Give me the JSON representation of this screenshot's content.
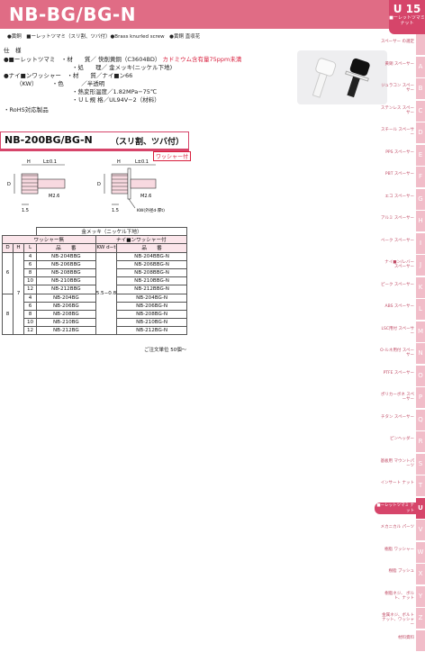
{
  "header": {
    "title": "NB-BG/BG-N",
    "badge_code": "U 15",
    "badge_label": "■ーレットツマミ ナット"
  },
  "taglines": "●黄銅　■ーレットツマミ（スリ割、ツバ付）●Brass knurled screw　●黄銅 直収花",
  "specs": {
    "section_title": "仕　様",
    "l1a": "●■ーレットツマミ　・材　　質／ 快削黄銅（C3604BD）",
    "l1b": "カドミウム含有量75ppm未満",
    "l2": "・処　　理／ 金メッキ(ニッケル下地)",
    "l3": "●ナイ■ンワッシャー　・材　　質／ナイ■ン66",
    "l4": "（KW）　　　・色　　　／半透明",
    "l5": "・熱変形温度／1.82MPa−75℃",
    "l6": "・ＵＬ規 格／UL94V−2（材料）",
    "rohs": "・RoHS対応製品"
  },
  "section": {
    "model": "NB-200BG/BG-N",
    "note": "（スリ割、ツバ付）",
    "washer_tag": "ワッシャー付"
  },
  "drawing": {
    "h": "H",
    "l": "L±0.1",
    "d": "D",
    "m": "M2.6",
    "dim15": "1.5",
    "kw": "KW(外径d·厚t)"
  },
  "table": {
    "caption": "金メッキ（ニッケル下地）",
    "group1": "ワッシャー無",
    "group2": "ナイ■ンワッシャー付",
    "col_d": "D",
    "col_h": "H",
    "col_l": "L",
    "col_p1": "品　　番",
    "col_kw": "KW d−t",
    "col_p2": "品　　番",
    "d_vals": [
      "6",
      "8"
    ],
    "h_val": "7",
    "kw_val": "5.5−0.8",
    "rows": [
      {
        "l": "4",
        "p1": "NB-204BBG",
        "p2": "NB-204BBG-N"
      },
      {
        "l": "6",
        "p1": "NB-206BBG",
        "p2": "NB-206BBG-N"
      },
      {
        "l": "8",
        "p1": "NB-208BBG",
        "p2": "NB-208BBG-N"
      },
      {
        "l": "10",
        "p1": "NB-210BBG",
        "p2": "NB-210BBG-N"
      },
      {
        "l": "12",
        "p1": "NB-212BBG",
        "p2": "NB-212BBG-N"
      },
      {
        "l": "4",
        "p1": "NB-204BG",
        "p2": "NB-204BG-N"
      },
      {
        "l": "6",
        "p1": "NB-206BG",
        "p2": "NB-206BG-N"
      },
      {
        "l": "8",
        "p1": "NB-208BG",
        "p2": "NB-208BG-N"
      },
      {
        "l": "10",
        "p1": "NB-210BG",
        "p2": "NB-210BG-N"
      },
      {
        "l": "12",
        "p1": "NB-212BG",
        "p2": "NB-212BG-N"
      }
    ],
    "footnote": "ご注文単位 50個〜"
  },
  "sidebar": [
    {
      "label": "スペーサー の選定",
      "tab": "",
      "active": false
    },
    {
      "label": "黄銅 スペーサー",
      "tab": "A",
      "active": false
    },
    {
      "label": "ジュラコン スペーサー",
      "tab": "B",
      "active": false
    },
    {
      "label": "ステンレス スペーサー",
      "tab": "C",
      "active": false
    },
    {
      "label": "スチール スペーサー",
      "tab": "D",
      "active": false
    },
    {
      "label": "PPS スペーサー",
      "tab": "E",
      "active": false
    },
    {
      "label": "PBT スペーサー",
      "tab": "F",
      "active": false
    },
    {
      "label": "エコ スペーサー",
      "tab": "G",
      "active": false
    },
    {
      "label": "アルミ スペーサー",
      "tab": "H",
      "active": false
    },
    {
      "label": "ベーク スペーサー",
      "tab": "I",
      "active": false
    },
    {
      "label": "ナイ■ン/レバー スペーサー",
      "tab": "J",
      "active": false
    },
    {
      "label": "ピーク スペーサー",
      "tab": "K",
      "active": false
    },
    {
      "label": "ABS スペーサー",
      "tab": "L",
      "active": false
    },
    {
      "label": "LSC用付 スペーサー",
      "tab": "M",
      "active": false
    },
    {
      "label": "O-ルネ用付 スペーサー",
      "tab": "N",
      "active": false
    },
    {
      "label": "PTFE スペーサー",
      "tab": "O",
      "active": false
    },
    {
      "label": "ポリカーボネ スペーサー",
      "tab": "P",
      "active": false
    },
    {
      "label": "チタン スペーサー",
      "tab": "Q",
      "active": false
    },
    {
      "label": "ピンヘッダー",
      "tab": "R",
      "active": false
    },
    {
      "label": "基板用 マウントパーツ",
      "tab": "S",
      "active": false
    },
    {
      "label": "インサート ナット",
      "tab": "T",
      "active": false
    },
    {
      "label": "■ーレットツマミ ナット",
      "tab": "U",
      "active": true
    },
    {
      "label": "メカニカル パーツ",
      "tab": "V",
      "active": false
    },
    {
      "label": "樹脂 ワッシャー",
      "tab": "W",
      "active": false
    },
    {
      "label": "樹脂 ブッシュ",
      "tab": "X",
      "active": false
    },
    {
      "label": "樹脂ネジ、 ボルト、ナット",
      "tab": "Y",
      "active": false
    },
    {
      "label": "金属ネジ、ボルト ナット、ワッシャー",
      "tab": "Z",
      "active": false
    },
    {
      "label": "材料資料",
      "tab": "",
      "active": false
    }
  ],
  "colors": {
    "accent": "#d6456a",
    "header": "#e06c85",
    "tab": "#f1bdc9",
    "warn": "#d81e3c"
  }
}
